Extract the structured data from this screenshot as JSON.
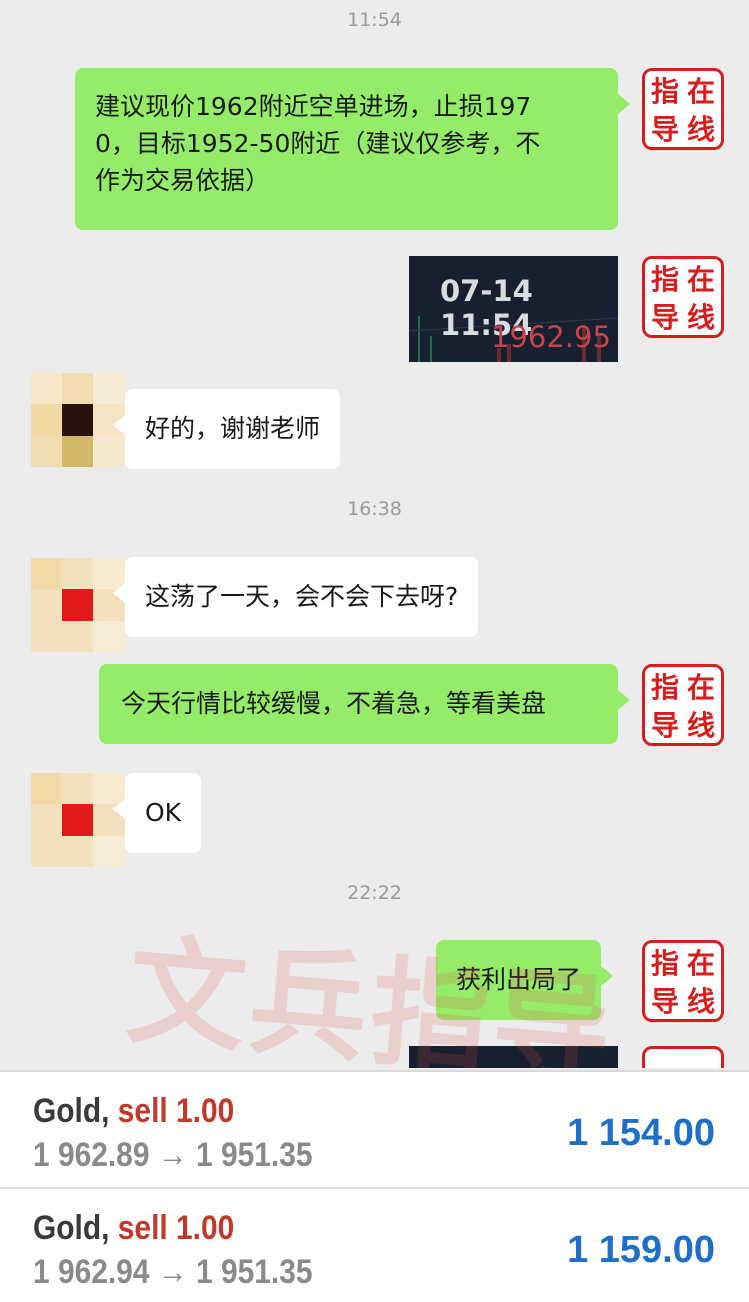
{
  "chat": {
    "times": [
      "11:54",
      "16:38",
      "22:22"
    ],
    "messages": {
      "m1": "建议现价1962附近空单进场，止损1970，目标1952-50附近（建议仅参考，不作为交易依据）",
      "m1_lines": [
        "建议现价1962附近空单进场，止损197",
        "0，目标1952-50附近（建议仅参考，不",
        "作为交易依据）"
      ],
      "m3": "好的，谢谢老师",
      "m4": "这荡了一天，会不会下去呀?",
      "m5": "今天行情比较缓慢，不着急，等看美盘",
      "m6": "OK",
      "m7": "获利出局了"
    },
    "screenshot": {
      "datetime": "07-14 11:54",
      "price": "1962.95"
    },
    "seal_chars": [
      "指",
      "在",
      "导",
      "线"
    ],
    "watermark": "文兵指导"
  },
  "trades": [
    {
      "symbol": "Gold,",
      "side": "sell 1.00",
      "prices": "1 962.89 → 1 951.35",
      "profit": "1 154.00"
    },
    {
      "symbol": "Gold,",
      "side": "sell 1.00",
      "prices": "1 962.94 → 1 951.35",
      "profit": "1 159.00"
    }
  ],
  "colors": {
    "bubble_green": "#95ec69",
    "seal_red": "#d81e1e",
    "profit_blue": "#1e6fc9",
    "sell_red": "#c0392b"
  }
}
